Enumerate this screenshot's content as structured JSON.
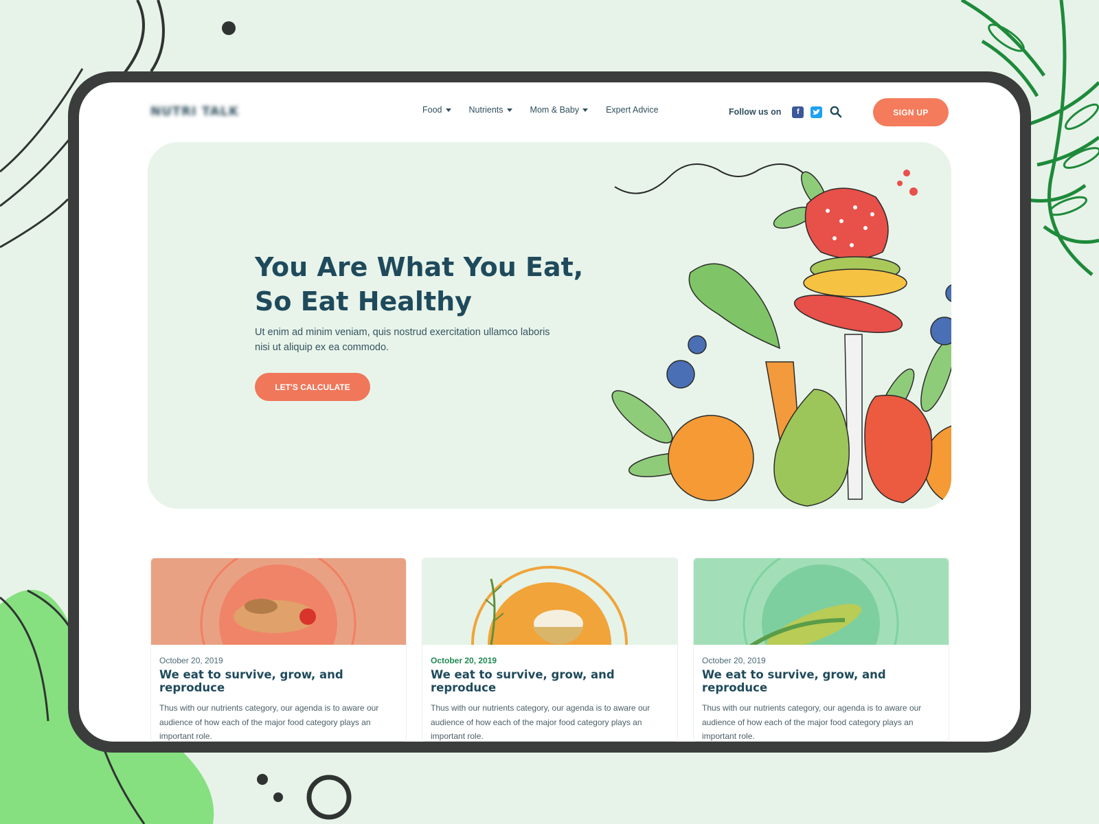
{
  "header": {
    "logo": "NUTRI TALK",
    "nav": [
      {
        "label": "Food",
        "has_dropdown": true
      },
      {
        "label": "Nutrients",
        "has_dropdown": true
      },
      {
        "label": "Mom & Baby",
        "has_dropdown": true
      },
      {
        "label": "Expert Advice",
        "has_dropdown": false
      }
    ],
    "follow_label": "Follow us on",
    "social_icons": [
      "facebook-icon",
      "twitter-icon"
    ],
    "signup_label": "SIGN UP"
  },
  "hero": {
    "title_line1": "You Are What You Eat,",
    "title_line2": "So Eat Healthy",
    "subtitle": "Ut enim ad minim veniam, quis nostrud exercitation ullamco laboris nisi ut aliquip ex ea commodo.",
    "cta_label": "LET'S CALCULATE"
  },
  "cards": [
    {
      "date": "October 20, 2019",
      "title": "We eat to survive, grow, and reproduce",
      "text": "Thus with our nutrients category, our agenda is to aware our audience of how each of the major food category plays an important role."
    },
    {
      "date": "October 20, 2019",
      "title": "We eat to survive, grow, and reproduce",
      "text": "Thus with our nutrients category, our agenda is to aware our audience of how each of the major food category plays an important role."
    },
    {
      "date": "October 20, 2019",
      "title": "We eat to survive, grow, and reproduce",
      "text": "Thus with our nutrients category, our agenda is to aware our audience of how each of the major food category plays an important role."
    }
  ],
  "colors": {
    "accent": "#f47b5b",
    "heading": "#1f4a5c",
    "hero_bg": "#e8f4ea",
    "page_bg": "#e7f3e9",
    "frame": "#3a3d3b"
  }
}
